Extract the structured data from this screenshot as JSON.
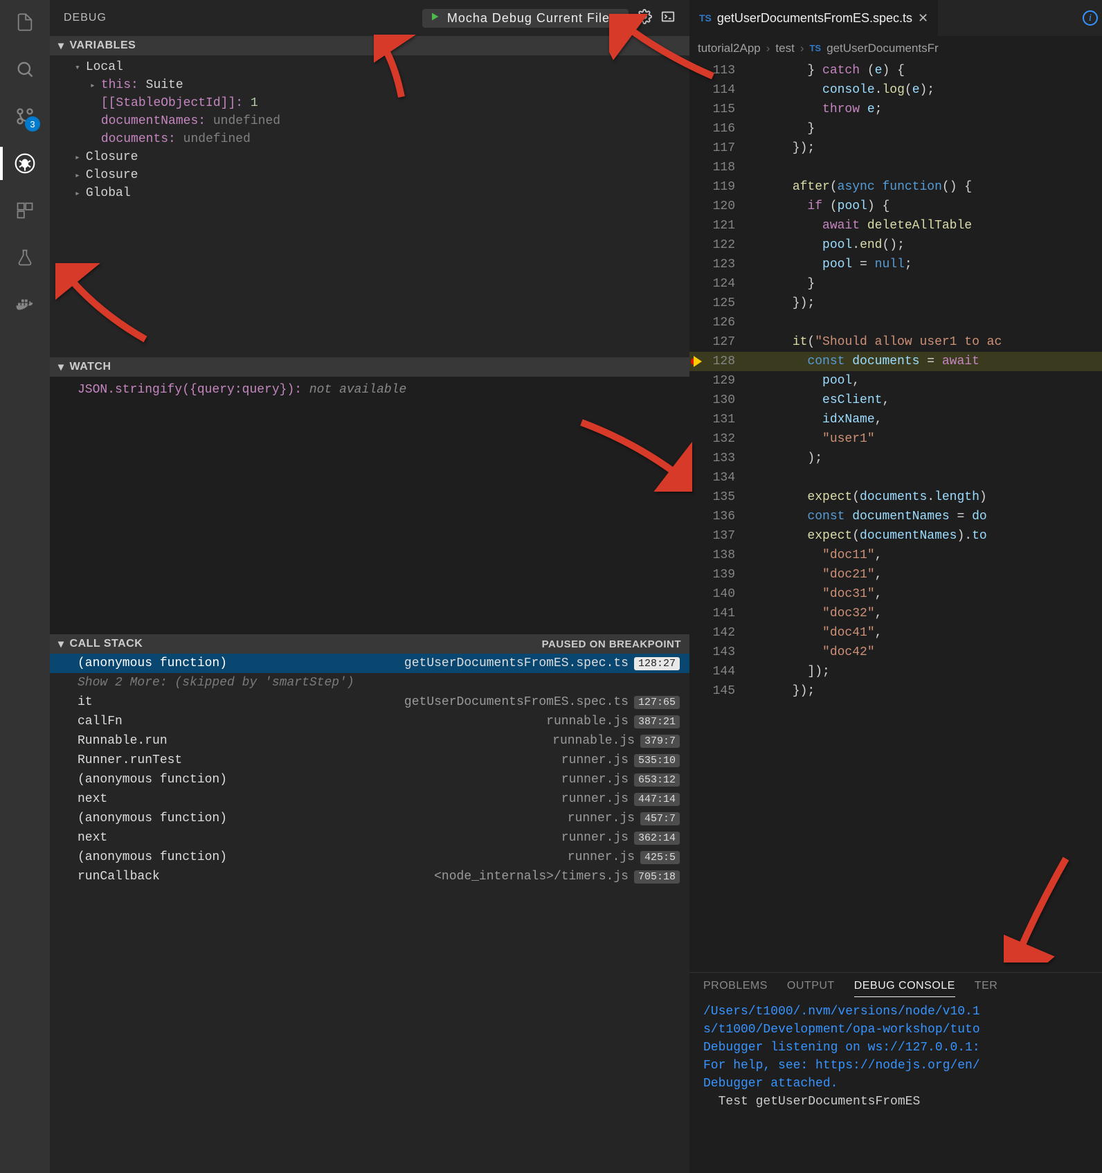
{
  "activity_bar": {
    "scm_badge": "3"
  },
  "debug_header": {
    "title": "DEBUG",
    "config": "Mocha Debug Current File"
  },
  "variables": {
    "title": "VARIABLES",
    "scopes": {
      "local": "Local",
      "closure1": "Closure",
      "closure2": "Closure",
      "global": "Global"
    },
    "local": {
      "this_key": "this:",
      "this_val": " Suite",
      "stable_key": "[[StableObjectId]]:",
      "stable_val": " 1",
      "docnames_key": "documentNames:",
      "docnames_val": " undefined",
      "docs_key": "documents:",
      "docs_val": " undefined"
    }
  },
  "watch": {
    "title": "WATCH",
    "expr": "JSON.stringify({query:query}):",
    "val": " not available"
  },
  "callstack": {
    "title": "CALL STACK",
    "status": "PAUSED ON BREAKPOINT",
    "skip": "Show 2 More: (skipped by 'smartStep')",
    "frames": [
      {
        "name": "(anonymous function)",
        "file": "getUserDocumentsFromES.spec.ts",
        "loc": "128:27",
        "current": true
      },
      {
        "name": "it",
        "file": "getUserDocumentsFromES.spec.ts",
        "loc": "127:65"
      },
      {
        "name": "callFn",
        "file": "runnable.js",
        "loc": "387:21"
      },
      {
        "name": "Runnable.run",
        "file": "runnable.js",
        "loc": "379:7"
      },
      {
        "name": "Runner.runTest",
        "file": "runner.js",
        "loc": "535:10"
      },
      {
        "name": "(anonymous function)",
        "file": "runner.js",
        "loc": "653:12"
      },
      {
        "name": "next",
        "file": "runner.js",
        "loc": "447:14"
      },
      {
        "name": "(anonymous function)",
        "file": "runner.js",
        "loc": "457:7"
      },
      {
        "name": "next",
        "file": "runner.js",
        "loc": "362:14"
      },
      {
        "name": "(anonymous function)",
        "file": "runner.js",
        "loc": "425:5"
      },
      {
        "name": "runCallback",
        "file": "<node_internals>/timers.js",
        "loc": "705:18"
      }
    ]
  },
  "editor": {
    "tab_file": "getUserDocumentsFromES.spec.ts",
    "breadcrumb": [
      "tutorial2App",
      "test",
      "getUserDocumentsFr"
    ],
    "lines": [
      {
        "n": 113,
        "t": "        } catch (e) {",
        "tok": [
          [
            "        } ",
            "punc"
          ],
          [
            "catch",
            "kw"
          ],
          [
            " (",
            "punc"
          ],
          [
            "e",
            "var"
          ],
          [
            ") {",
            "punc"
          ]
        ]
      },
      {
        "n": 114,
        "t": "          console.log(e);",
        "tok": [
          [
            "          ",
            "punc"
          ],
          [
            "console",
            "var"
          ],
          [
            ".",
            "punc"
          ],
          [
            "log",
            "fn"
          ],
          [
            "(",
            "punc"
          ],
          [
            "e",
            "var"
          ],
          [
            ");",
            "punc"
          ]
        ]
      },
      {
        "n": 115,
        "t": "          throw e;",
        "tok": [
          [
            "          ",
            "punc"
          ],
          [
            "throw",
            "kw"
          ],
          [
            " ",
            "punc"
          ],
          [
            "e",
            "var"
          ],
          [
            ";",
            "punc"
          ]
        ]
      },
      {
        "n": 116,
        "t": "        }",
        "tok": [
          [
            "        }",
            "punc"
          ]
        ]
      },
      {
        "n": 117,
        "t": "      });",
        "tok": [
          [
            "      });",
            "punc"
          ]
        ]
      },
      {
        "n": 118,
        "t": "",
        "tok": []
      },
      {
        "n": 119,
        "t": "      after(async function() {",
        "tok": [
          [
            "      ",
            "punc"
          ],
          [
            "after",
            "fn"
          ],
          [
            "(",
            "punc"
          ],
          [
            "async",
            "blue"
          ],
          [
            " ",
            "punc"
          ],
          [
            "function",
            "blue"
          ],
          [
            "() {",
            "punc"
          ]
        ]
      },
      {
        "n": 120,
        "t": "        if (pool) {",
        "tok": [
          [
            "        ",
            "punc"
          ],
          [
            "if",
            "kw"
          ],
          [
            " (",
            "punc"
          ],
          [
            "pool",
            "var"
          ],
          [
            ") {",
            "punc"
          ]
        ]
      },
      {
        "n": 121,
        "t": "          await deleteAllTable",
        "tok": [
          [
            "          ",
            "punc"
          ],
          [
            "await",
            "kw"
          ],
          [
            " ",
            "punc"
          ],
          [
            "deleteAllTable",
            "fn"
          ]
        ]
      },
      {
        "n": 122,
        "t": "          pool.end();",
        "tok": [
          [
            "          ",
            "punc"
          ],
          [
            "pool",
            "var"
          ],
          [
            ".",
            "punc"
          ],
          [
            "end",
            "fn"
          ],
          [
            "();",
            "punc"
          ]
        ]
      },
      {
        "n": 123,
        "t": "          pool = null;",
        "tok": [
          [
            "          ",
            "punc"
          ],
          [
            "pool",
            "var"
          ],
          [
            " = ",
            "punc"
          ],
          [
            "null",
            "blue"
          ],
          [
            ";",
            "punc"
          ]
        ]
      },
      {
        "n": 124,
        "t": "        }",
        "tok": [
          [
            "        }",
            "punc"
          ]
        ]
      },
      {
        "n": 125,
        "t": "      });",
        "tok": [
          [
            "      });",
            "punc"
          ]
        ]
      },
      {
        "n": 126,
        "t": "",
        "tok": []
      },
      {
        "n": 127,
        "t": "      it(\"Should allow user1 to ac",
        "tok": [
          [
            "      ",
            "punc"
          ],
          [
            "it",
            "fn"
          ],
          [
            "(",
            "punc"
          ],
          [
            "\"Should allow user1 to ac",
            "str"
          ]
        ]
      },
      {
        "n": 128,
        "t": "        const documents = await ",
        "tok": [
          [
            "        ",
            "punc"
          ],
          [
            "const",
            "blue"
          ],
          [
            " ",
            "punc"
          ],
          [
            "documents",
            "var"
          ],
          [
            " = ",
            "punc"
          ],
          [
            "await",
            "kw"
          ],
          [
            " ",
            "punc"
          ]
        ],
        "hl": true,
        "bp": true
      },
      {
        "n": 129,
        "t": "          pool,",
        "tok": [
          [
            "          ",
            "punc"
          ],
          [
            "pool",
            "var"
          ],
          [
            ",",
            "punc"
          ]
        ]
      },
      {
        "n": 130,
        "t": "          esClient,",
        "tok": [
          [
            "          ",
            "punc"
          ],
          [
            "esClient",
            "var"
          ],
          [
            ",",
            "punc"
          ]
        ]
      },
      {
        "n": 131,
        "t": "          idxName,",
        "tok": [
          [
            "          ",
            "punc"
          ],
          [
            "idxName",
            "var"
          ],
          [
            ",",
            "punc"
          ]
        ]
      },
      {
        "n": 132,
        "t": "          \"user1\"",
        "tok": [
          [
            "          ",
            "punc"
          ],
          [
            "\"user1\"",
            "str"
          ]
        ]
      },
      {
        "n": 133,
        "t": "        );",
        "tok": [
          [
            "        );",
            "punc"
          ]
        ]
      },
      {
        "n": 134,
        "t": "",
        "tok": []
      },
      {
        "n": 135,
        "t": "        expect(documents.length)",
        "tok": [
          [
            "        ",
            "punc"
          ],
          [
            "expect",
            "fn"
          ],
          [
            "(",
            "punc"
          ],
          [
            "documents",
            "var"
          ],
          [
            ".",
            "punc"
          ],
          [
            "length",
            "var"
          ],
          [
            ")",
            "punc"
          ]
        ]
      },
      {
        "n": 136,
        "t": "        const documentNames = do",
        "tok": [
          [
            "        ",
            "punc"
          ],
          [
            "const",
            "blue"
          ],
          [
            " ",
            "punc"
          ],
          [
            "documentNames",
            "var"
          ],
          [
            " = ",
            "punc"
          ],
          [
            "do",
            "var"
          ]
        ]
      },
      {
        "n": 137,
        "t": "        expect(documentNames).to",
        "tok": [
          [
            "        ",
            "punc"
          ],
          [
            "expect",
            "fn"
          ],
          [
            "(",
            "punc"
          ],
          [
            "documentNames",
            "var"
          ],
          [
            ").",
            "punc"
          ],
          [
            "to",
            "var"
          ]
        ]
      },
      {
        "n": 138,
        "t": "          \"doc11\",",
        "tok": [
          [
            "          ",
            "punc"
          ],
          [
            "\"doc11\"",
            "str"
          ],
          [
            ",",
            "punc"
          ]
        ]
      },
      {
        "n": 139,
        "t": "          \"doc21\",",
        "tok": [
          [
            "          ",
            "punc"
          ],
          [
            "\"doc21\"",
            "str"
          ],
          [
            ",",
            "punc"
          ]
        ]
      },
      {
        "n": 140,
        "t": "          \"doc31\",",
        "tok": [
          [
            "          ",
            "punc"
          ],
          [
            "\"doc31\"",
            "str"
          ],
          [
            ",",
            "punc"
          ]
        ]
      },
      {
        "n": 141,
        "t": "          \"doc32\",",
        "tok": [
          [
            "          ",
            "punc"
          ],
          [
            "\"doc32\"",
            "str"
          ],
          [
            ",",
            "punc"
          ]
        ]
      },
      {
        "n": 142,
        "t": "          \"doc41\",",
        "tok": [
          [
            "          ",
            "punc"
          ],
          [
            "\"doc41\"",
            "str"
          ],
          [
            ",",
            "punc"
          ]
        ]
      },
      {
        "n": 143,
        "t": "          \"doc42\"",
        "tok": [
          [
            "          ",
            "punc"
          ],
          [
            "\"doc42\"",
            "str"
          ]
        ]
      },
      {
        "n": 144,
        "t": "        ]);",
        "tok": [
          [
            "        ]);",
            "punc"
          ]
        ]
      },
      {
        "n": 145,
        "t": "      });",
        "tok": [
          [
            "      });",
            "punc"
          ]
        ]
      }
    ]
  },
  "panel": {
    "tabs": {
      "problems": "PROBLEMS",
      "output": "OUTPUT",
      "debug": "DEBUG CONSOLE",
      "terminal": "TER"
    },
    "lines": [
      {
        "text": "/Users/t1000/.nvm/versions/node/v10.1",
        "cls": "blue"
      },
      {
        "text": "s/t1000/Development/opa-workshop/tuto",
        "cls": "blue"
      },
      {
        "text": "Debugger listening on ws://127.0.0.1:",
        "cls": "blue"
      },
      {
        "text": "For help, see: https://nodejs.org/en/",
        "cls": "blue"
      },
      {
        "text": "Debugger attached.",
        "cls": "blue"
      },
      {
        "text": "",
        "cls": ""
      },
      {
        "text": "  Test getUserDocumentsFromES",
        "cls": ""
      }
    ]
  }
}
